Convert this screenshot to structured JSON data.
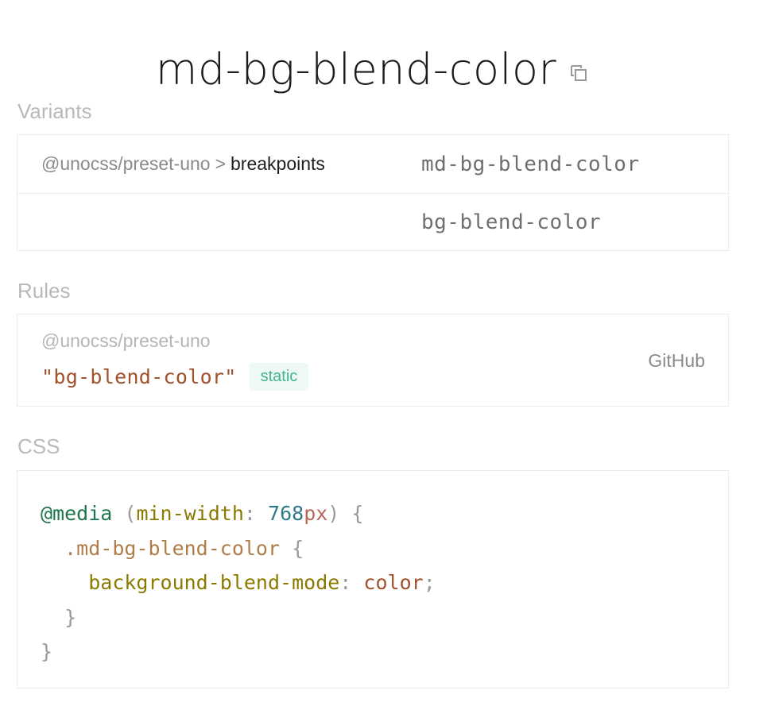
{
  "header": {
    "title": "md-bg-blend-color",
    "copy_icon": "copy-icon"
  },
  "variants": {
    "label": "Variants",
    "rows": [
      {
        "source_pkg": "@unocss/preset-uno",
        "separator": ">",
        "source_name": "breakpoints",
        "name": "md-bg-blend-color"
      },
      {
        "source_pkg": "",
        "separator": "",
        "source_name": "",
        "name": "bg-blend-color"
      }
    ]
  },
  "rules": {
    "label": "Rules",
    "source": "@unocss/preset-uno",
    "rule_string": "\"bg-blend-color\"",
    "badge": "static",
    "github_label": "GitHub"
  },
  "css": {
    "label": "CSS",
    "at": "@media",
    "open_paren": "(",
    "media_prop": "min-width",
    "colon": ":",
    "media_num": "768",
    "media_unit": "px",
    "close_paren": ")",
    "open_brace": "{",
    "selector": ".md-bg-blend-color",
    "property": "background-blend-mode",
    "value": "color",
    "semicolon": ";",
    "close_brace": "}"
  },
  "colors": {
    "badge_text": "#3eb489",
    "badge_bg": "#eef8f4",
    "string": "#a0522d"
  }
}
